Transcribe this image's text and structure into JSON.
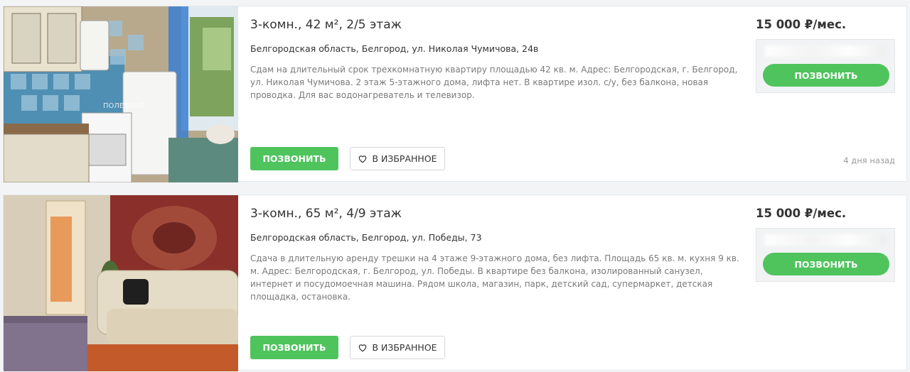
{
  "listings": [
    {
      "title": "3-комн., 42 м², 2/5 этаж",
      "address": "Белгородская область, Белгород, ул. Николая Чумичова, 24в",
      "description": "Сдам на длительный срок трехкомнатную квартиру площадью 42 кв. м. Адрес: Белгородская, г. Белгород, ул. Николая Чумичова. 2 этаж 5-этажного дома, лифта нет. В квартире изол. с/у, без балкона, новая проводка. Для вас водонагреватель и телевизор.",
      "price": "15 000 ₽/мес.",
      "call_label": "ПОЗВОНИТЬ",
      "favorite_label": "В ИЗБРАННОЕ",
      "phone_call_label": "ПОЗВОНИТЬ",
      "date": "4 дня назад",
      "photo_watermark": "ПОЛЕЗНЫЕ\nВИДЫ"
    },
    {
      "title": "3-комн., 65 м², 4/9 этаж",
      "address": "Белгородская область, Белгород, ул. Победы, 73",
      "description": "Сдача в длительную аренду трешки на 4 этаже 9-этажного дома, без лифта. Площадь 65 кв. м. кухня 9 кв. м. Адрес: Белгородская, г. Белгород, ул. Победы. В квартире без балкона, изолированный санузел, интернет и посудомоечная машина. Рядом школа, магазин, парк, детский сад, супермаркет, детская площадка, остановка.",
      "price": "15 000 ₽/мес.",
      "call_label": "ПОЗВОНИТЬ",
      "favorite_label": "В ИЗБРАННОЕ",
      "phone_call_label": "ПОЗВОНИТЬ",
      "date": ""
    }
  ],
  "colors": {
    "accent_green": "#4fc45d",
    "page_bg": "#f3f4f5"
  },
  "icons": {
    "favorite": "heart-outline-icon"
  }
}
